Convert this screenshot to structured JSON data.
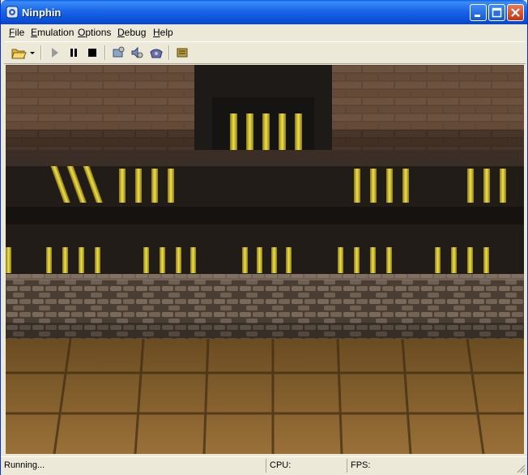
{
  "window": {
    "title": "Ninphin"
  },
  "menu": {
    "file": {
      "accel": "F",
      "rest": "ile"
    },
    "emulation": {
      "accel": "E",
      "rest": "mulation"
    },
    "options": {
      "accel": "O",
      "rest": "ptions"
    },
    "debug": {
      "accel": "D",
      "rest": "ebug"
    },
    "help": {
      "accel": "H",
      "rest": "elp"
    }
  },
  "toolbar": {
    "icons": [
      "open-folder-icon",
      "play-icon",
      "pause-icon",
      "stop-icon",
      "cpu-settings-icon",
      "audio-settings-icon",
      "controller-settings-icon",
      "plugin-settings-icon"
    ]
  },
  "status": {
    "state": "Running...",
    "cpu_label": "CPU:",
    "fps_label": "FPS:"
  },
  "colors": {
    "title_blue": "#0b4fd6",
    "face": "#ece9d8",
    "bar_yellow": "#e8d23a",
    "stone": "#6b5a48",
    "floor": "#a07a3c"
  }
}
